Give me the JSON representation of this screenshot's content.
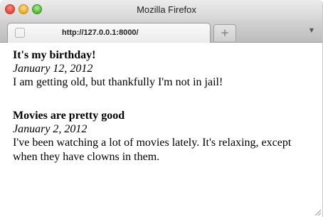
{
  "window": {
    "title": "Mozilla Firefox"
  },
  "tabs": [
    {
      "label": "http://127.0.0.1:8000/"
    }
  ],
  "new_tab_label": "+",
  "list_tabs_label": "▼",
  "posts": [
    {
      "title": "It's my birthday!",
      "date": "January 12, 2012",
      "body": "I am getting old, but thankfully I'm not in jail!"
    },
    {
      "title": "Movies are pretty good",
      "date": "January 2, 2012",
      "body": "I've been watching a lot of movies lately. It's relaxing, except when they have clowns in them."
    }
  ],
  "colors": {
    "close": "#e0443e",
    "minimize": "#e6a82b",
    "maximize": "#4fb43a"
  }
}
